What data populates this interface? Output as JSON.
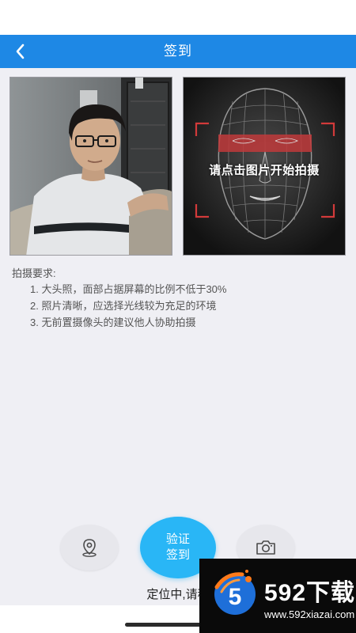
{
  "header": {
    "title": "签到",
    "back_icon": "chevron-left-icon"
  },
  "colors": {
    "nav_bg": "#1e88e5",
    "verify_button": "#29b6f6",
    "page_bg": "#efeff4"
  },
  "photos": {
    "captured_alt": "captured portrait photo",
    "face_template_prompt": "请点击图片开始拍摄"
  },
  "requirements": {
    "title": "拍摄要求:",
    "items": [
      "1. 大头照，面部占据屏幕的比例不低于30%",
      "2. 照片清晰，应选择光线较为充足的环境",
      "3. 无前置摄像头的建议他人协助拍摄"
    ]
  },
  "actions": {
    "location_icon": "location-pin-icon",
    "camera_icon": "camera-icon",
    "verify_line1": "验证",
    "verify_line2": "签到"
  },
  "status": {
    "text": "定位中,请稍"
  },
  "watermark": {
    "brand": "592下载",
    "url": "www.592xiazai.com",
    "badge_text": "5"
  }
}
